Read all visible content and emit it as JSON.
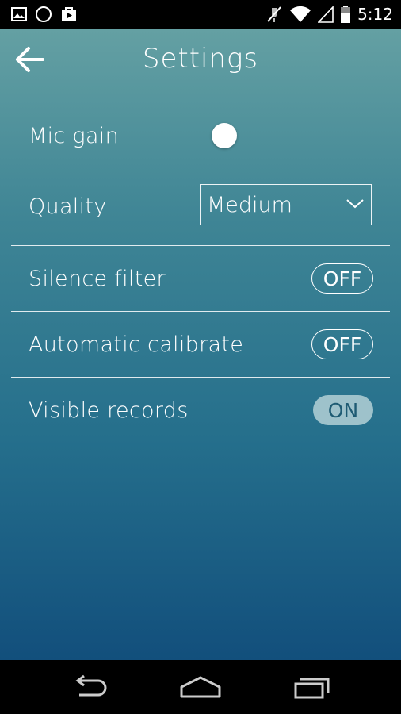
{
  "status_bar": {
    "time": "5:12",
    "left_icons": [
      "image-icon",
      "circle-icon",
      "play-store-icon"
    ],
    "right_icons": [
      "mute-icon",
      "wifi-icon",
      "signal-icon",
      "battery-icon"
    ]
  },
  "header": {
    "title": "Settings",
    "back_icon": "arrow-left-icon"
  },
  "settings": {
    "mic_gain": {
      "label": "Mic gain",
      "value": 0.08
    },
    "quality": {
      "label": "Quality",
      "selected": "Medium"
    },
    "silence_filter": {
      "label": "Silence filter",
      "state": "OFF"
    },
    "automatic_calibrate": {
      "label": "Automatic calibrate",
      "state": "OFF"
    },
    "visible_records": {
      "label": "Visible records",
      "state": "ON"
    }
  },
  "nav_bar": {
    "icons": [
      "back-nav-icon",
      "home-nav-icon",
      "recents-nav-icon"
    ]
  },
  "colors": {
    "gradient_top": "#64a0a3",
    "gradient_bottom": "#124f7c",
    "toggle_on_bg": "#9ec2cb",
    "toggle_on_text": "#1e5b73"
  }
}
